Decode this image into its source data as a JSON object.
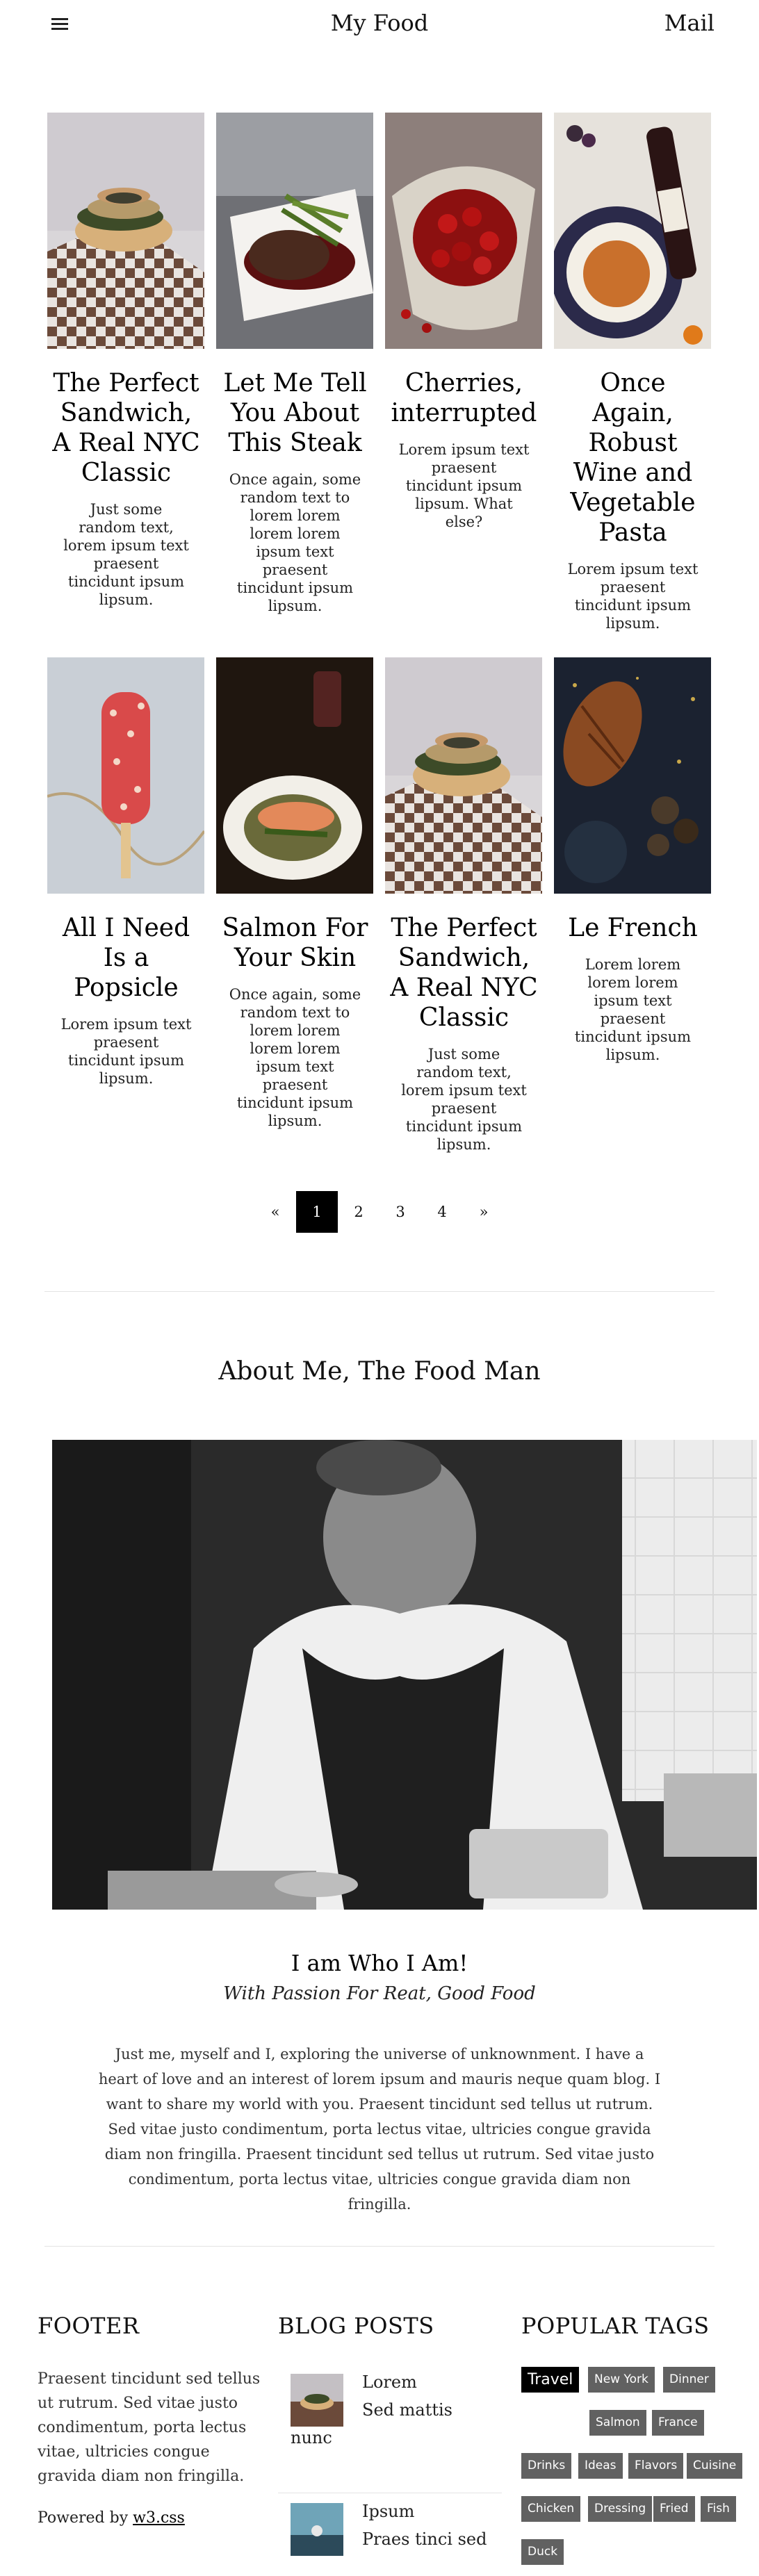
{
  "header": {
    "title": "My Food",
    "mail_label": "Mail"
  },
  "posts_row1": [
    {
      "title": "The Perfect Sandwich, A Real NYC Classic",
      "text": "Just some random text, lorem ipsum text praesent tincidunt ipsum lipsum."
    },
    {
      "title": "Let Me Tell You About This Steak",
      "text": "Once again, some random text to lorem lorem lorem lorem ipsum text praesent tincidunt ipsum lipsum."
    },
    {
      "title": "Cherries, interrupted",
      "text": "Lorem ipsum text praesent tincidunt ipsum lipsum. What else?"
    },
    {
      "title": "Once Again, Robust Wine and Vegetable Pasta",
      "text": "Lorem ipsum text praesent tincidunt ipsum lipsum."
    }
  ],
  "posts_row2": [
    {
      "title": "All I Need Is a Popsicle",
      "text": "Lorem ipsum text praesent tincidunt ipsum lipsum."
    },
    {
      "title": "Salmon For Your Skin",
      "text": "Once again, some random text to lorem lorem lorem lorem ipsum text praesent tincidunt ipsum lipsum."
    },
    {
      "title": "The Perfect Sandwich, A Real NYC Classic",
      "text": "Just some random text, lorem ipsum text praesent tincidunt ipsum lipsum."
    },
    {
      "title": "Le French",
      "text": "Lorem lorem lorem lorem ipsum text praesent tincidunt ipsum lipsum."
    }
  ],
  "pagination": {
    "prev": "«",
    "pages": [
      "1",
      "2",
      "3",
      "4"
    ],
    "active": "1",
    "next": "»"
  },
  "about": {
    "heading": "About Me, The Food Man",
    "name": "I am Who I Am!",
    "tagline": "With Passion For Reat, Good Food",
    "body": "Just me, myself and I, exploring the universe of unknownment. I have a heart of love and an interest of lorem ipsum and mauris neque quam blog. I want to share my world with you. Praesent tincidunt sed tellus ut rutrum. Sed vitae justo condimentum, porta lectus vitae, ultricies congue gravida diam non fringilla. Praesent tincidunt sed tellus ut rutrum. Sed vitae justo condimentum, porta lectus vitae, ultricies congue gravida diam non fringilla."
  },
  "footer": {
    "heading": "FOOTER",
    "text": "Praesent tincidunt sed tellus ut rutrum. Sed vitae justo condimentum, porta lectus vitae, ultricies congue gravida diam non fringilla.",
    "powered_prefix": "Powered by ",
    "powered_link": "w3.css"
  },
  "blog_posts": {
    "heading": "BLOG POSTS",
    "items": [
      {
        "title": "Lorem",
        "subtitle": "Sed mattis",
        "continued": "nunc"
      },
      {
        "title": "Ipsum",
        "subtitle": "Praes tinci sed"
      }
    ]
  },
  "popular_tags": {
    "heading": "POPULAR TAGS",
    "tags": [
      "Travel",
      "New York",
      "Dinner",
      "Salmon",
      "France",
      "Drinks",
      "Ideas",
      "Flavors",
      "Cuisine",
      "Chicken",
      "Dressing",
      "Fried",
      "Fish",
      "Duck"
    ]
  }
}
